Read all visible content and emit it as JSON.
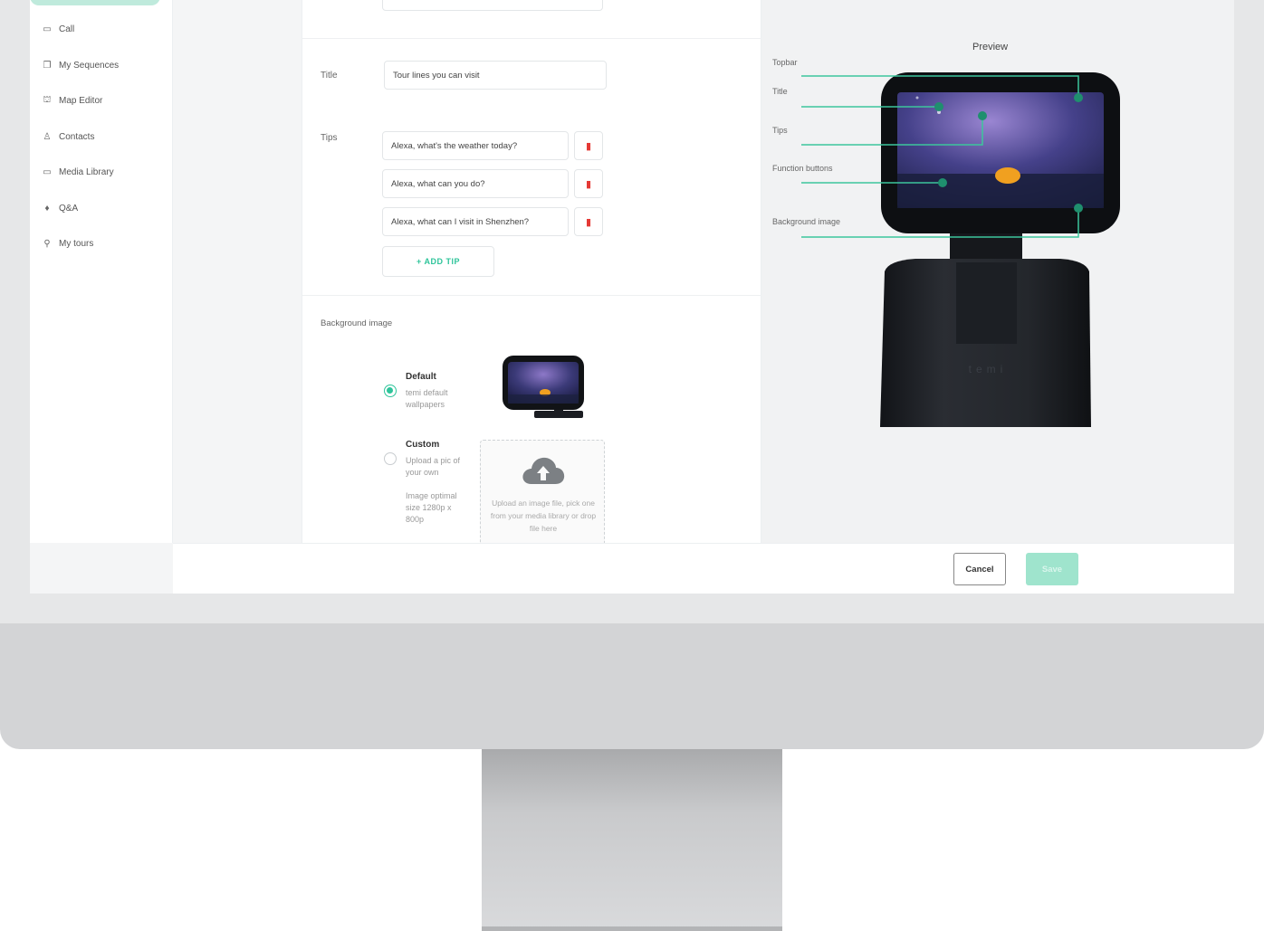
{
  "sidebar": {
    "items": [
      {
        "icon": "video-camera-icon",
        "label": "Call"
      },
      {
        "icon": "copy-icon",
        "label": "My Sequences"
      },
      {
        "icon": "map-icon",
        "label": "Map Editor"
      },
      {
        "icon": "person-icon",
        "label": "Contacts"
      },
      {
        "icon": "folder-icon",
        "label": "Media Library"
      },
      {
        "icon": "microphone-icon",
        "label": "Q&A"
      },
      {
        "icon": "tours-icon",
        "label": "My tours"
      }
    ]
  },
  "form": {
    "title_label": "Title",
    "title_value": "Tour lines you can visit",
    "tips_label": "Tips",
    "tips": [
      "Alexa, what's the weather today?",
      "Alexa, what can you do?",
      "Alexa, what can I visit in Shenzhen?"
    ],
    "add_tip_label": "+ ADD TIP",
    "background_label": "Background image",
    "default_title": "Default",
    "default_desc": "temi default wallpapers",
    "custom_title": "Custom",
    "custom_desc": "Upload a pic of your own",
    "custom_size": "Image optimal size 1280p x 800p",
    "upload_hint": "Upload an image file, pick one from your media library or drop file here",
    "selected_background": "Default"
  },
  "preview": {
    "title": "Preview",
    "callouts": [
      "Topbar",
      "Title",
      "Tips",
      "Function buttons",
      "Background image"
    ],
    "robot_logo": "temi"
  },
  "footer": {
    "cancel_label": "Cancel",
    "save_label": "Save"
  },
  "colors": {
    "accent": "#2ec49a",
    "delete": "#e53935"
  }
}
